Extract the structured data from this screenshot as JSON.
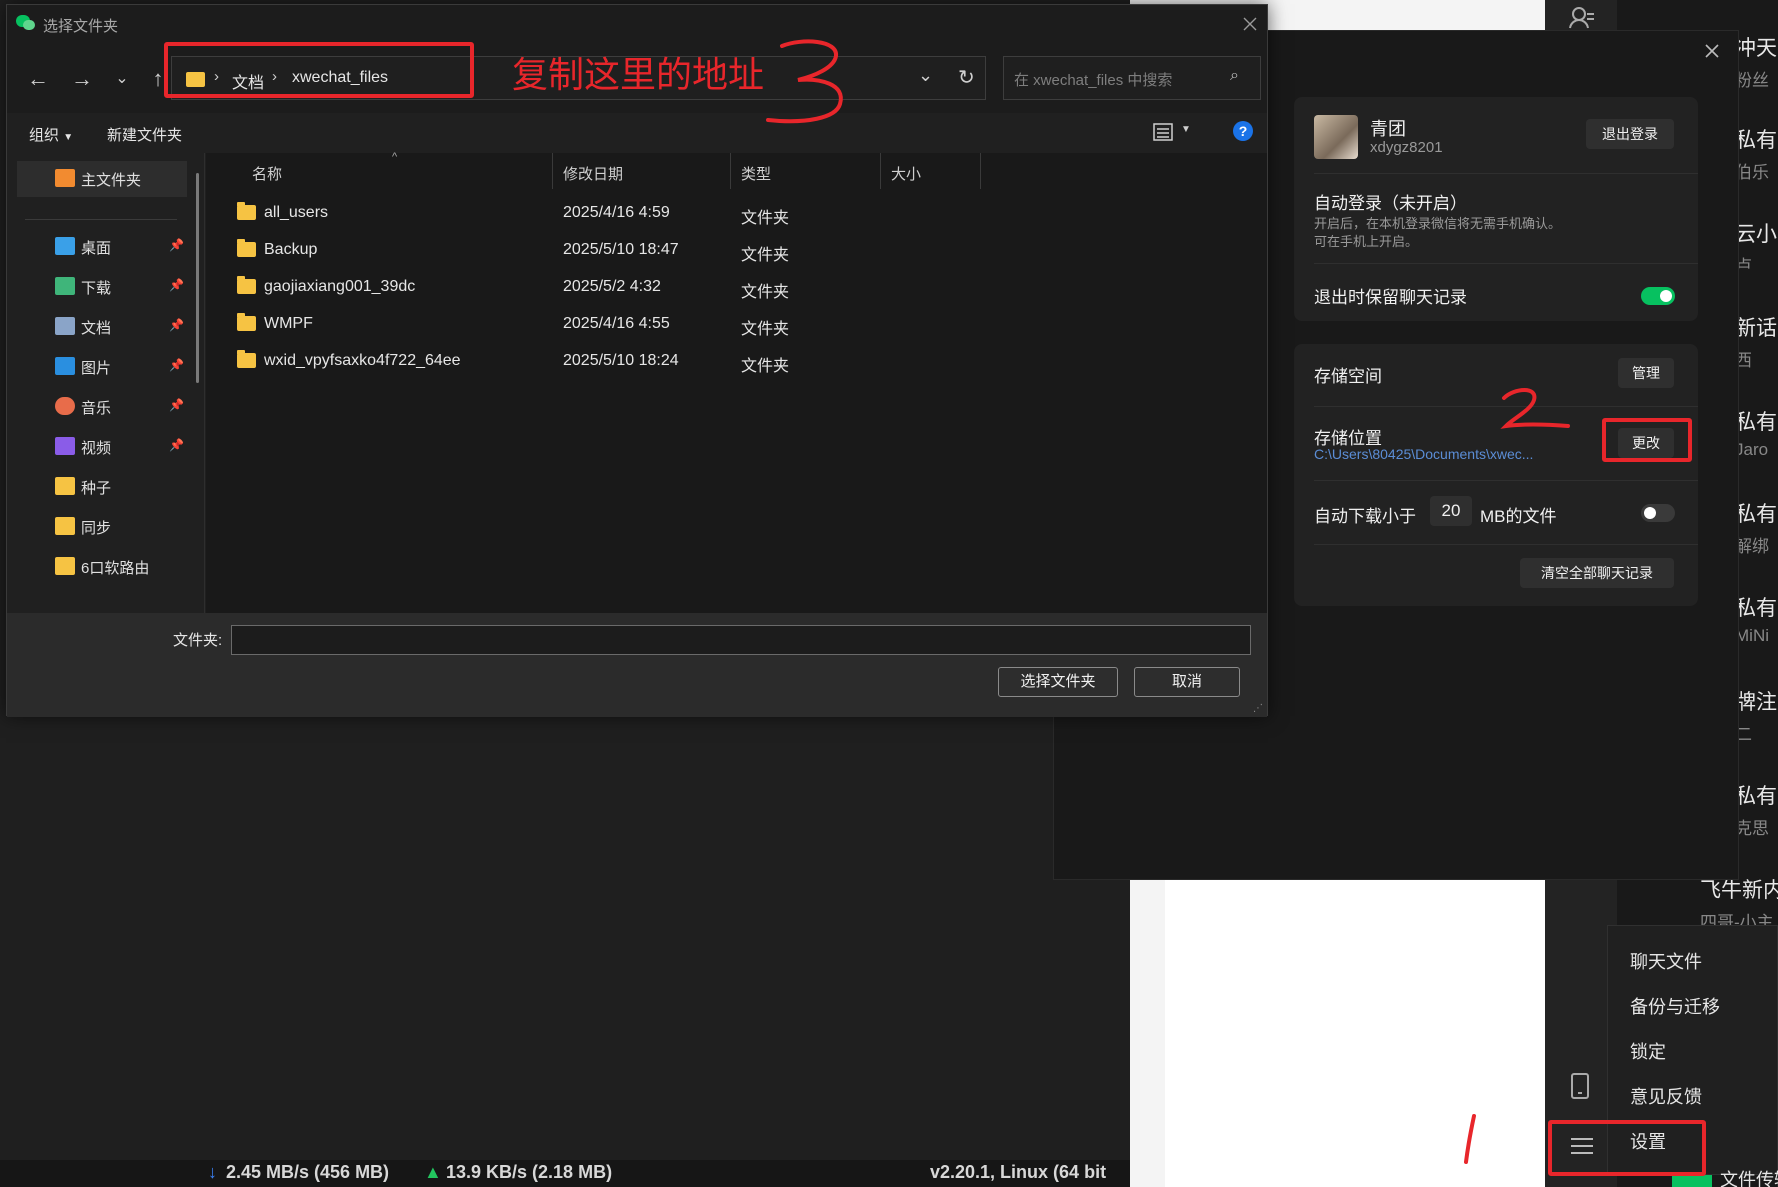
{
  "dialog": {
    "title": "选择文件夹",
    "breadcrumb": [
      "文档",
      "xwechat_files"
    ],
    "search_placeholder": "在 xwechat_files 中搜索",
    "toolbar": {
      "organize": "组织",
      "new_folder": "新建文件夹"
    },
    "nav": [
      {
        "label": "主文件夹",
        "icon": "home-icon",
        "pinned": false
      },
      {
        "label": "桌面",
        "icon": "desktop-icon",
        "pinned": true
      },
      {
        "label": "下载",
        "icon": "download-icon",
        "pinned": true
      },
      {
        "label": "文档",
        "icon": "document-icon",
        "pinned": true
      },
      {
        "label": "图片",
        "icon": "pictures-icon",
        "pinned": true
      },
      {
        "label": "音乐",
        "icon": "music-icon",
        "pinned": true
      },
      {
        "label": "视频",
        "icon": "video-icon",
        "pinned": true
      },
      {
        "label": "种子",
        "icon": "folder-icon",
        "pinned": false
      },
      {
        "label": "同步",
        "icon": "folder-icon",
        "pinned": false
      },
      {
        "label": "6口软路由",
        "icon": "folder-icon",
        "pinned": false
      }
    ],
    "columns": {
      "name": "名称",
      "date": "修改日期",
      "type": "类型",
      "size": "大小"
    },
    "files": [
      {
        "name": "all_users",
        "date": "2025/4/16 4:59",
        "type": "文件夹"
      },
      {
        "name": "Backup",
        "date": "2025/5/10 18:47",
        "type": "文件夹"
      },
      {
        "name": "gaojiaxiang001_39dc",
        "date": "2025/5/2 4:32",
        "type": "文件夹"
      },
      {
        "name": "WMPF",
        "date": "2025/4/16 4:55",
        "type": "文件夹"
      },
      {
        "name": "wxid_vpyfsaxko4f722_64ee",
        "date": "2025/5/10 18:24",
        "type": "文件夹"
      }
    ],
    "folder_label": "文件夹:",
    "folder_value": "",
    "select_button": "选择文件夹",
    "cancel_button": "取消"
  },
  "annotations": {
    "copy_address": "复制这里的地址",
    "step1": "1",
    "step2": "2",
    "step3": "3"
  },
  "wechat": {
    "account": {
      "name": "青团",
      "id": "xdygz8201",
      "logout": "退出登录"
    },
    "auto_login": {
      "title": "自动登录（未开启）",
      "desc1": "开启后，在本机登录微信将无需手机确认。",
      "desc2": "可在手机上开启。"
    },
    "keep_history": {
      "label": "退出时保留聊天记录",
      "enabled": true
    },
    "storage": {
      "title": "存储空间",
      "manage": "管理",
      "location_label": "存储位置",
      "location_path": "C:\\Users\\80425\\Documents\\xwec...",
      "change": "更改",
      "auto_download_prefix": "自动下载小于",
      "auto_download_size": "20",
      "auto_download_suffix": "MB的文件",
      "auto_download_enabled": false,
      "clear": "清空全部聊天记录"
    },
    "menu": [
      "聊天文件",
      "备份与迁移",
      "锁定",
      "意见反馈",
      "设置"
    ],
    "chat_titles": [
      "冲天",
      "私有",
      "云小",
      "新话",
      "私有",
      "私有",
      "私有",
      "牌注",
      "私有",
      "飞牛新内"
    ],
    "chat_subs": [
      "粉丝",
      "伯乐",
      "卢",
      "西",
      "Jaro",
      "解绑",
      "MiNi",
      "二",
      "克思",
      "四哥-小主"
    ],
    "bottom_right_text": "文件传输"
  },
  "statusbar": {
    "down": "2.45 MB/s (456 MB)",
    "up": "13.9 KB/s (2.18 MB)",
    "version": "v2.20.1, Linux (64 bit"
  },
  "colors": {
    "annotation": "#e8262b",
    "toggle_on": "#07c160",
    "accent_blue": "#0a84ff"
  }
}
